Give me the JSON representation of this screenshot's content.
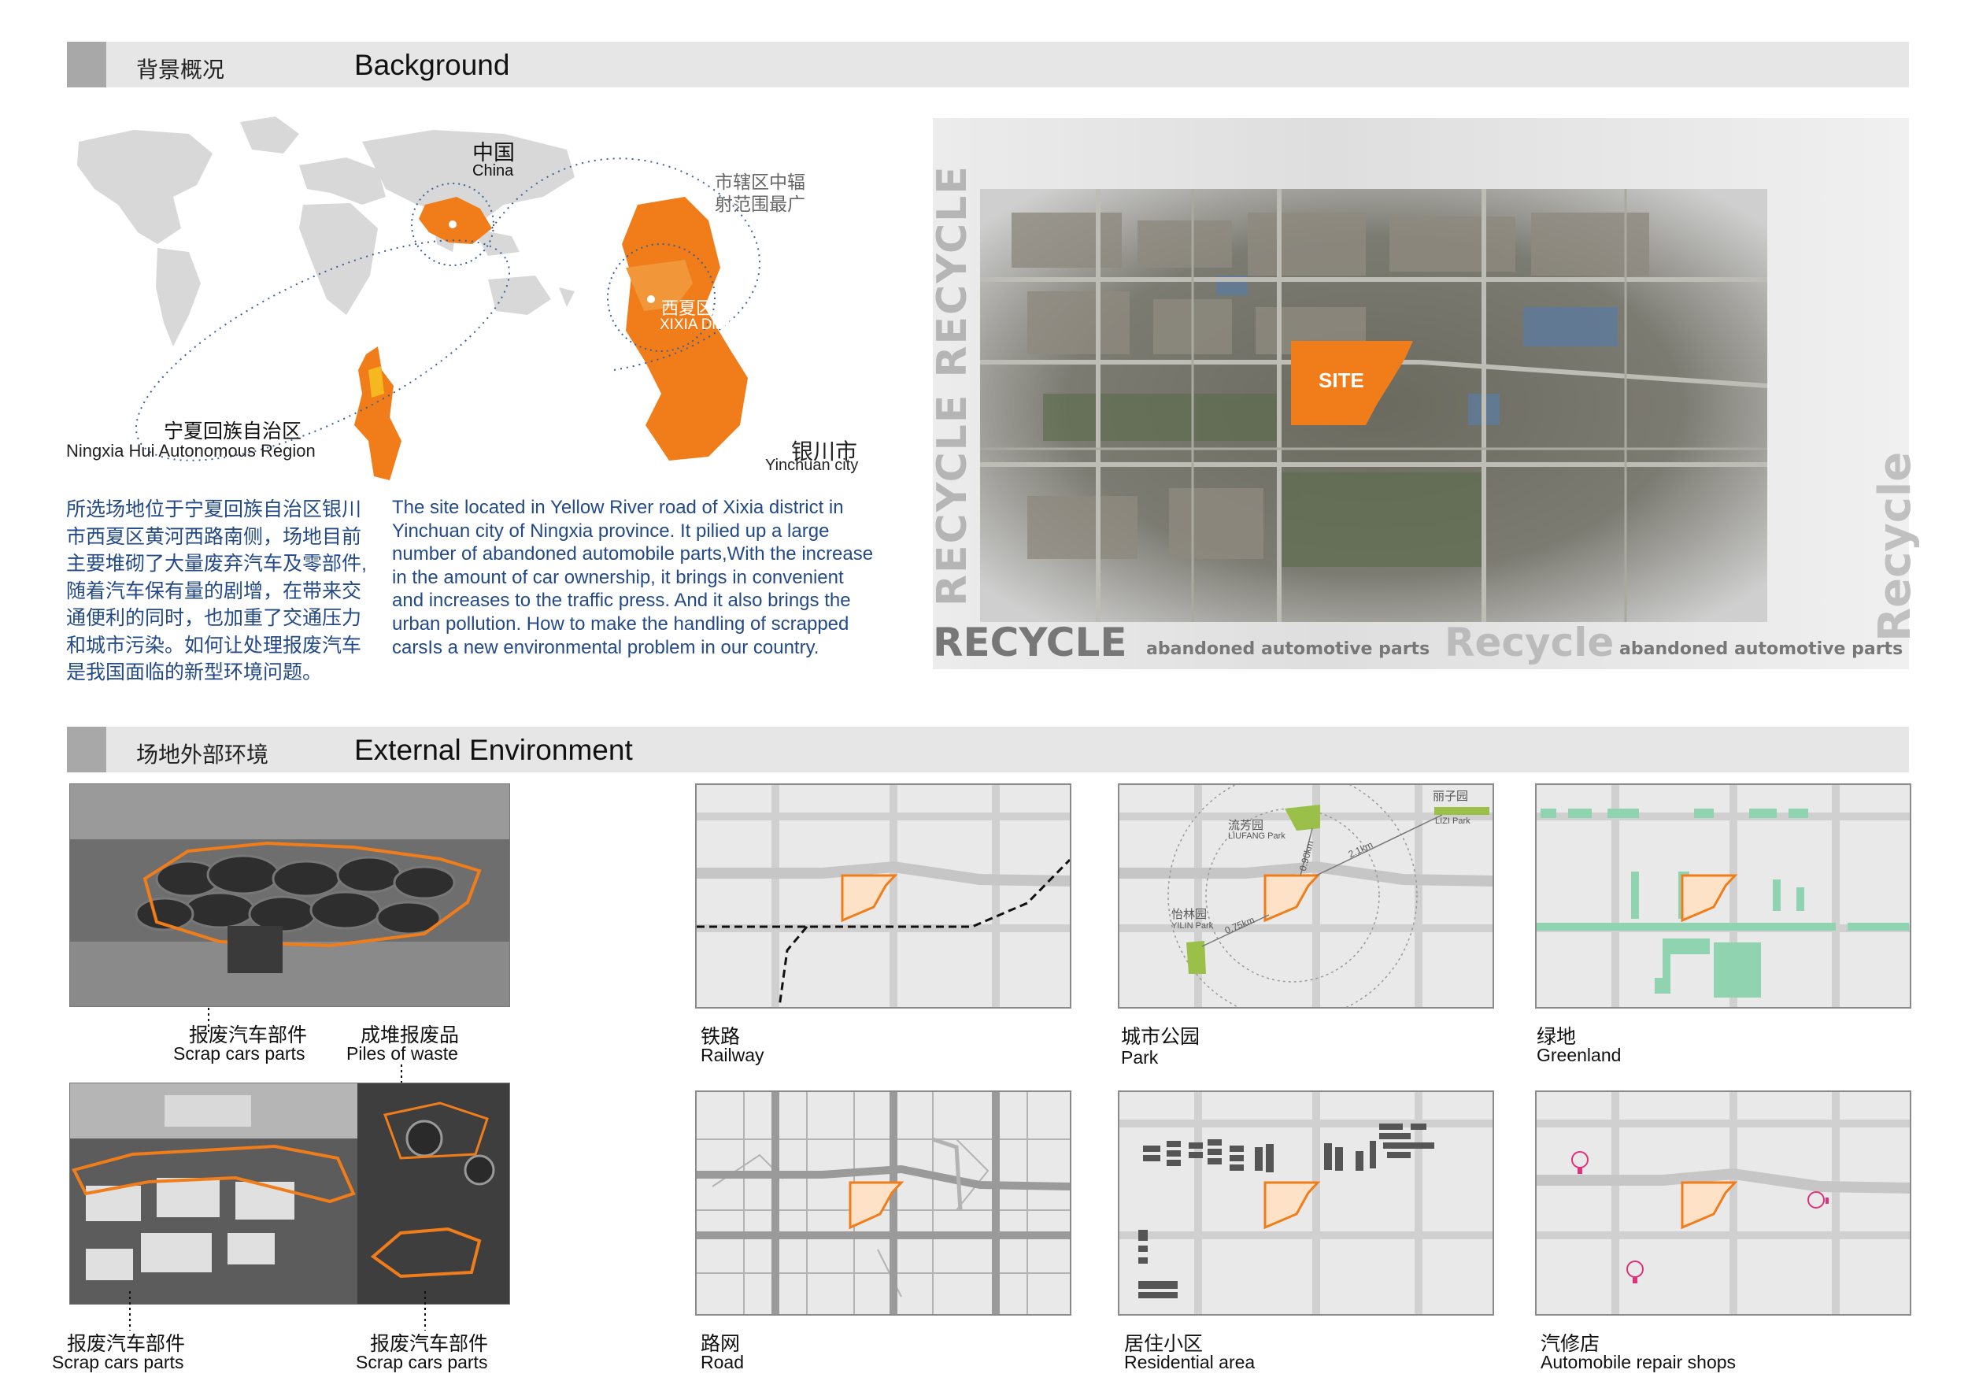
{
  "section1": {
    "title_cn": "背景概况",
    "title_en": "Background"
  },
  "section2": {
    "title_cn": "场地外部环境",
    "title_en": "External  Environment"
  },
  "map": {
    "china_cn": "中国",
    "china_en": "China",
    "ningxia_cn": "宁夏回族自治区",
    "ningxia_en": "Ningxia Hui Autonomous Region",
    "district_note_line1": "市辖区中辐",
    "district_note_line2": "射范围最广",
    "xixia_cn": "西夏区",
    "xixia_en": "XIXIA District",
    "yinchuan_cn": "银川市",
    "yinchuan_en": "Yinchuan city"
  },
  "text": {
    "cn_lines": [
      "所选场地位于宁夏回族自治区银川",
      "市西夏区黄河西路南侧，场地目前",
      "主要堆砌了大量废弃汽车及零部件,",
      "随着汽车保有量的剧增，在带来交",
      "通便利的同时，也加重了交通压力",
      "和城市污染。如何让处理报废汽车",
      "是我国面临的新型环境问题。"
    ],
    "en_lines": [
      "The site  located in  Yellow River road of Xixia district in",
      "Yinchuan city of Ningxia province. It  pilied up a large",
      "number of abandoned automobile  parts,With the increase",
      "in the amount of car ownership, it brings in convenient",
      "and increases to the traffic press. And  it also brings the",
      "urban pollution. How to make the handling of scrapped",
      "carsIs a new environmental problem in our country."
    ]
  },
  "aerial": {
    "site_label": "SITE",
    "vertical1": "RECYCLE RECYCLE",
    "vertical2": "Recycle",
    "banner1_big": "RECYCLE",
    "banner1_small": "abandoned automotive parts",
    "banner2_big": "Recycle",
    "banner2_small": "abandoned automotive parts"
  },
  "photos": {
    "top_left_cn": "报废汽车部件",
    "top_left_en": "Scrap cars parts",
    "top_right_cn": "成堆报废品",
    "top_right_en": "Piles of waste",
    "bottom_left_cn": "报废汽车部件",
    "bottom_left_en": "Scrap cars parts",
    "bottom_right_cn": "报废汽车部件",
    "bottom_right_en": "Scrap cars parts"
  },
  "panels": [
    {
      "cn": "铁路",
      "en": "Railway"
    },
    {
      "cn": "城市公园",
      "en": "Park"
    },
    {
      "cn": "绿地",
      "en": "Greenland"
    },
    {
      "cn": "路网",
      "en": "Road"
    },
    {
      "cn": "居住小区",
      "en": "Residential area"
    },
    {
      "cn": "汽修店",
      "en": "Automobile repair shops"
    }
  ],
  "park_labels": {
    "liufang_cn": "流芳园",
    "liufang_en": "LIUFANG Park",
    "lizi_cn": "丽子园",
    "lizi_en": "LIZI Park",
    "yilin_cn": "怡林园",
    "yilin_en": "YILIN Park",
    "d1": "0.90km",
    "d2": "2.1km",
    "d3": "0.75km"
  },
  "colors": {
    "accent": "#f07d1a",
    "text_blue": "#234a86",
    "park_green": "#9bc04a",
    "green_land": "#8fd3b0",
    "repair_pink": "#e0327a"
  }
}
